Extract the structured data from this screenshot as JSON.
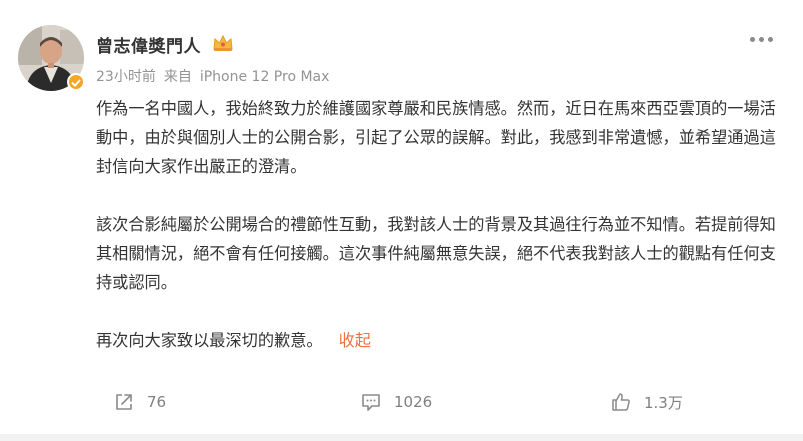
{
  "post": {
    "author_name": "曾志偉獎門人",
    "time": "23小时前",
    "source_prefix": "来自",
    "source_device": "iPhone 12 Pro Max",
    "paragraphs": [
      "作為一名中國人，我始終致力於維護國家尊嚴和民族情感。然而，近日在馬來西亞雲頂的一場活動中，由於與個別人士的公開合影，引起了公眾的誤解。對此，我感到非常遺憾，並希望通過這封信向大家作出嚴正的澄清。",
      "該次合影純屬於公開場合的禮節性互動，我對該人士的背景及其過往行為並不知情。若提前得知其相關情況，絕不會有任何接觸。這次事件純屬無意失誤，絕不代表我對該人士的觀點有任何支持或認同。"
    ],
    "last_paragraph": "再次向大家致以最深切的歉意。",
    "collapse_label": "收起"
  },
  "actions": {
    "repost_count": "76",
    "comment_count": "1026",
    "like_count": "1.3万"
  },
  "icons": {
    "verified": "verified-badge-icon",
    "crown": "crown-icon",
    "more": "more-dots-icon",
    "repost": "repost-icon",
    "comment": "comment-icon",
    "like": "thumbs-up-icon"
  },
  "colors": {
    "text": "#333333",
    "meta": "#939393",
    "link": "#eb7340",
    "verified": "#f5a623"
  }
}
